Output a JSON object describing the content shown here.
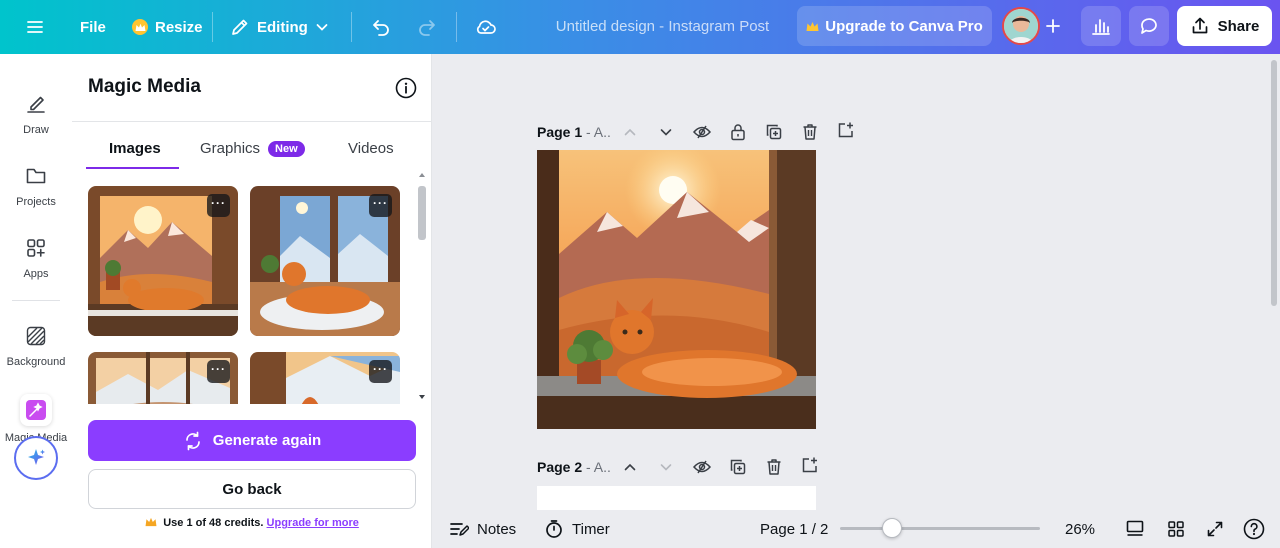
{
  "topbar": {
    "file_label": "File",
    "resize_label": "Resize",
    "editing_label": "Editing",
    "doc_title": "Untitled design - Instagram Post",
    "upgrade_label": "Upgrade to Canva Pro",
    "share_label": "Share"
  },
  "rail": {
    "items": [
      {
        "label": "Draw",
        "icon": "pen-icon"
      },
      {
        "label": "Projects",
        "icon": "folder-icon"
      },
      {
        "label": "Apps",
        "icon": "apps-icon"
      },
      {
        "label": "Background",
        "icon": "background-pattern-icon"
      },
      {
        "label": "Magic Media",
        "icon": "magic-media-icon"
      }
    ]
  },
  "panel": {
    "title": "Magic Media",
    "tabs": [
      {
        "label": "Images",
        "active": true
      },
      {
        "label": "Graphics",
        "badge": "New"
      },
      {
        "label": "Videos"
      }
    ],
    "generate_label": "Generate again",
    "back_label": "Go back",
    "credits_text": "Use 1 of 48 credits.",
    "credits_link": "Upgrade for more"
  },
  "canvas": {
    "page1_title": "Page 1",
    "page1_suffix": " - A..",
    "page2_title": "Page 2",
    "page2_suffix": " - A.."
  },
  "bottombar": {
    "notes_label": "Notes",
    "timer_label": "Timer",
    "page_indicator": "Page 1 / 2",
    "zoom_value": "26%",
    "zoom_fraction": 0.26
  },
  "colors": {
    "accent": "#8b3dff",
    "topbar_start": "#00c4cc",
    "topbar_end": "#6a54f0"
  }
}
